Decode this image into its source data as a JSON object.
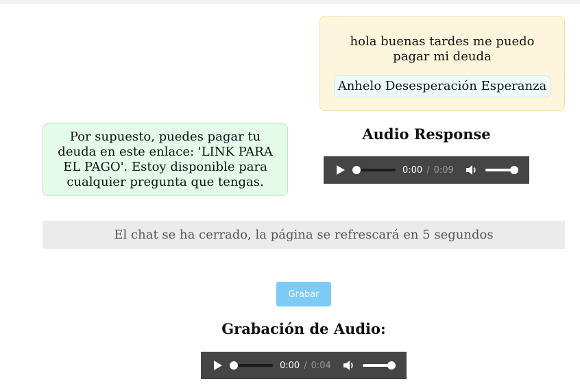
{
  "chat": {
    "user_message": "hola buenas tardes me puedo pagar mi deuda",
    "emotion_tags": "Anhelo Desesperación Esperanza",
    "bot_message": "Por supuesto, puedes pagar tu deuda en este enlace: 'LINK PARA EL PAGO'. Estoy disponible para cualquier pregunta que tengas."
  },
  "audio_response": {
    "heading": "Audio Response",
    "current_time": "0:00",
    "separator": "/",
    "duration": "0:09",
    "progress": 0.0,
    "volume": 1.0
  },
  "status": {
    "message": "El chat se ha cerrado, la página se refrescará en 5 segundos"
  },
  "recording": {
    "button_label": "Grabar",
    "button_color": "#7ccbf8",
    "heading": "Grabación de Audio:",
    "current_time": "0:00",
    "separator": "/",
    "duration": "0:04",
    "progress": 0.0,
    "volume": 1.0
  },
  "colors": {
    "user_bubble": "#fdf6dc",
    "bot_bubble": "#e3fbe8",
    "player_bg": "#454545"
  },
  "icons": [
    "play-icon",
    "volume-icon"
  ]
}
